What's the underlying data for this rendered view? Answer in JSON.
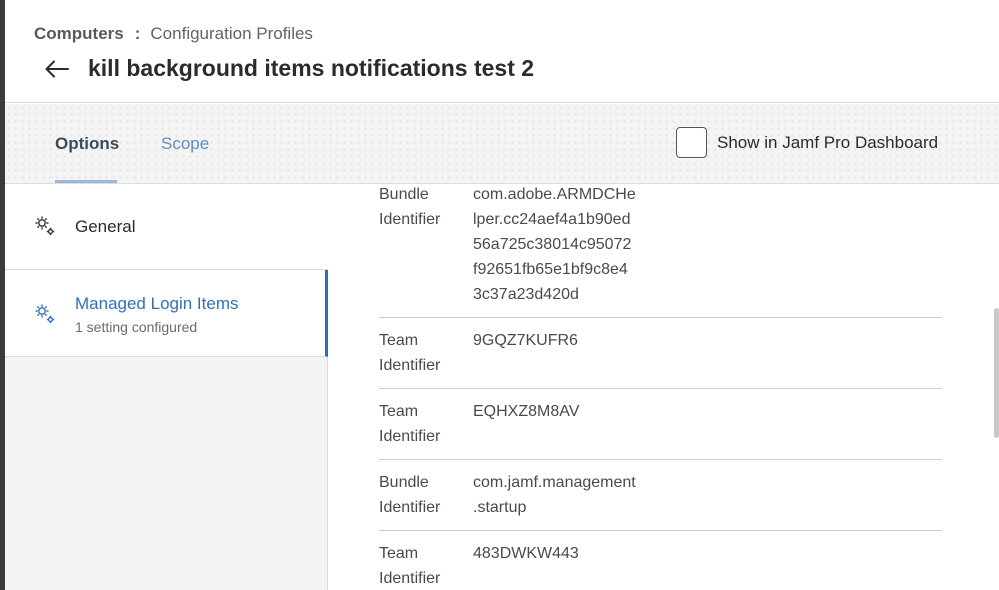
{
  "breadcrumb": {
    "root": "Computers",
    "separator": ":",
    "current": "Configuration Profiles"
  },
  "header": {
    "back_icon": "arrow-left-icon",
    "title": "kill background items notifications test 2"
  },
  "tabs": [
    {
      "label": "Options",
      "active": true
    },
    {
      "label": "Scope",
      "active": false
    }
  ],
  "dashboard_toggle": {
    "label": "Show in Jamf Pro Dashboard",
    "checked": false
  },
  "sidebar": {
    "items": [
      {
        "label": "General",
        "icon": "gear-icon"
      },
      {
        "label": "Managed Login Items",
        "subtitle": "1 setting configured",
        "icon": "gear-icon",
        "active": true
      }
    ]
  },
  "rules": [
    {
      "label": "Bundle\nIdentifier",
      "value": "com.adobe.ARMDCHe\nlper.cc24aef4a1b90ed\n56a725c38014c95072\nf92651fb65e1bf9c8e4\n3c37a23d420d"
    },
    {
      "label": "Team\nIdentifier",
      "value": "9GQZ7KUFR6"
    },
    {
      "label": "Team\nIdentifier",
      "value": "EQHXZ8M8AV"
    },
    {
      "label": "Bundle\nIdentifier",
      "value": "com.jamf.management\n.startup"
    },
    {
      "label": "Team\nIdentifier",
      "value": "483DWKW443"
    }
  ],
  "colors": {
    "accent": "#2f72b8",
    "tab_inactive": "#5f8fc0"
  }
}
